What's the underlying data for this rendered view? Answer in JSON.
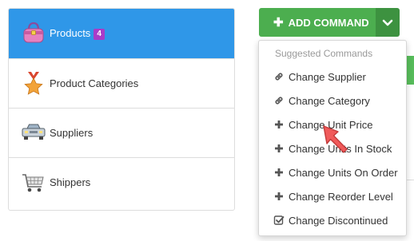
{
  "nav": {
    "items": [
      {
        "label": "Products",
        "badge": "4",
        "icon": "handbag-icon",
        "active": true
      },
      {
        "label": "Product Categories",
        "icon": "medal-icon"
      },
      {
        "label": "Suppliers",
        "icon": "car-icon"
      },
      {
        "label": "Shippers",
        "icon": "shopping-cart-icon"
      }
    ]
  },
  "toolbar": {
    "add_command_label": "ADD COMMAND",
    "button_color": "#4cae4f",
    "caret_color": "#3d9240"
  },
  "menu": {
    "header": "Suggested Commands",
    "items": [
      {
        "label": "Change Supplier",
        "icon": "link-icon"
      },
      {
        "label": "Change Category",
        "icon": "link-icon"
      },
      {
        "label": "Change Unit Price",
        "icon": "plus-icon"
      },
      {
        "label": "Change Units In Stock",
        "icon": "plus-icon"
      },
      {
        "label": "Change Units On Order",
        "icon": "plus-icon"
      },
      {
        "label": "Change Reorder Level",
        "icon": "plus-icon"
      },
      {
        "label": "Change Discontinued",
        "icon": "checkbox-icon"
      }
    ]
  },
  "colors": {
    "active_nav": "#2f97e8",
    "badge": "#a93cc8",
    "cursor": "#f05a5a"
  }
}
